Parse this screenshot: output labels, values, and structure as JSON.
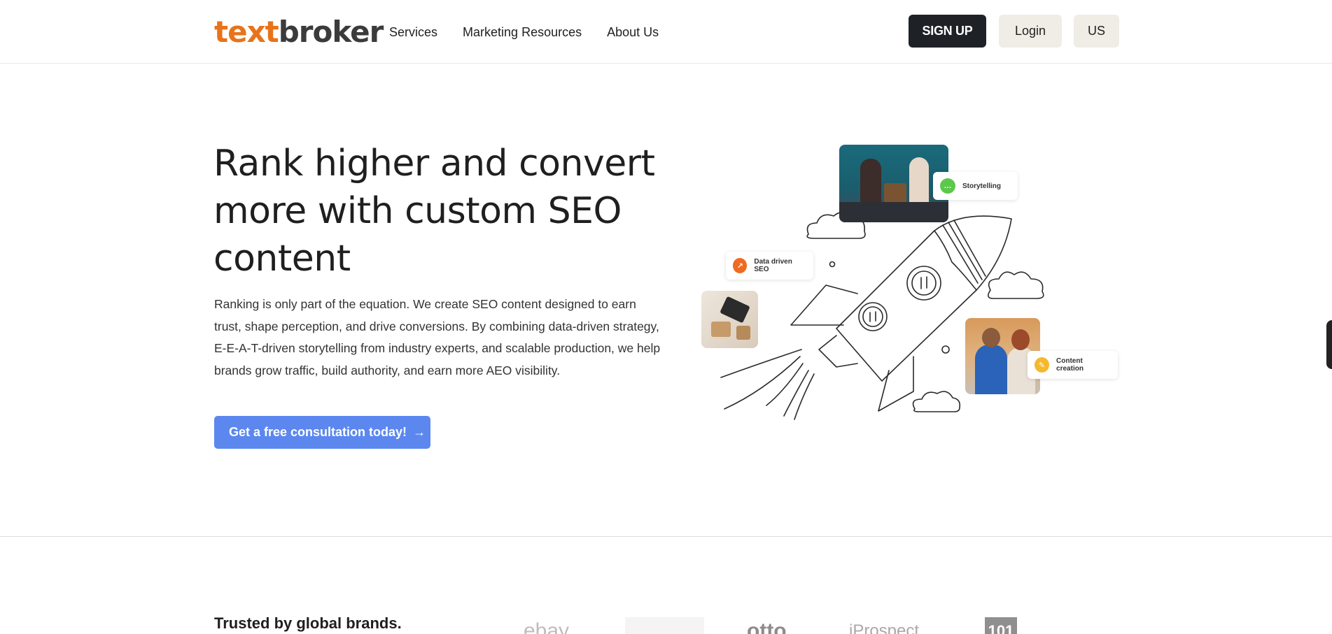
{
  "header": {
    "logo": {
      "part1": "text",
      "part2": "broker"
    },
    "nav": [
      {
        "label": "Services"
      },
      {
        "label": "Marketing Resources"
      },
      {
        "label": "About Us"
      }
    ],
    "signup_label": "SIGN UP",
    "login_label": "Login",
    "locale_label": "US"
  },
  "hero": {
    "title": "Rank higher and convert more with custom SEO content",
    "description": "Ranking is only part of the equation. We create SEO content designed to earn trust, shape perception, and drive conversions. By combining data-driven strategy, E-E-A-T-driven storytelling from industry experts, and scalable production, we help brands grow traffic, build authority, and earn more AEO visibility.",
    "cta_label": "Get a free consultation today!",
    "cta_arrow": "→"
  },
  "illustration": {
    "chips": [
      {
        "label": "Storytelling",
        "icon": "chat-icon",
        "color": "#5cc84b"
      },
      {
        "label": "Data driven SEO",
        "icon": "trend-icon",
        "color": "#ef6a23"
      },
      {
        "label": "Content creation",
        "icon": "pencil-icon",
        "color": "#f5b82e"
      }
    ]
  },
  "trusted": {
    "heading": "Trusted by global brands.",
    "logos": [
      {
        "text": "ebay"
      },
      {
        "text": "otto"
      },
      {
        "text": "iProspect"
      },
      {
        "text": "101"
      }
    ]
  },
  "colors": {
    "brand_orange": "#e8731a",
    "cta_blue": "#5b87ef",
    "dark": "#1e2227",
    "light_btn": "#efede6"
  }
}
